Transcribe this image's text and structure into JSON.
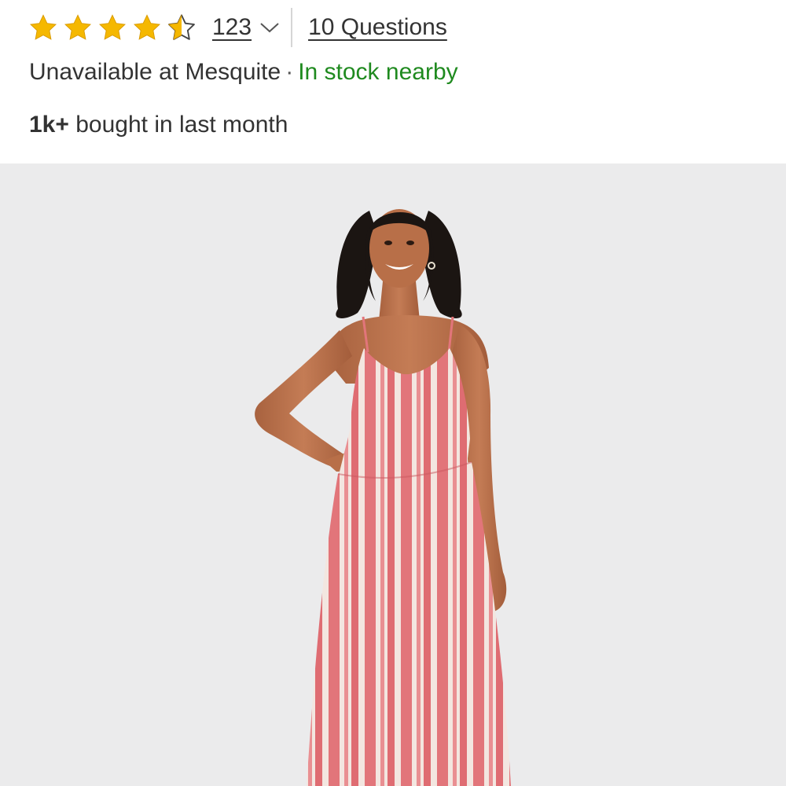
{
  "rating": {
    "stars_value": 4.5,
    "stars_max": 5,
    "star_color": "#f5b800",
    "review_count": "123",
    "questions_label": "10 Questions"
  },
  "availability": {
    "store_text": "Unavailable at Mesquite",
    "separator": "·",
    "nearby_text": "In stock nearby",
    "nearby_color": "#1f8a1f"
  },
  "purchases": {
    "bold_text": "1k+",
    "rest_text": " bought in last month"
  },
  "product_image": {
    "subject": "model wearing red and white striped midi sundress",
    "dress_stripe_red": "#e2757a",
    "dress_stripe_white": "#f3e6e0",
    "background": "#ebebec"
  }
}
